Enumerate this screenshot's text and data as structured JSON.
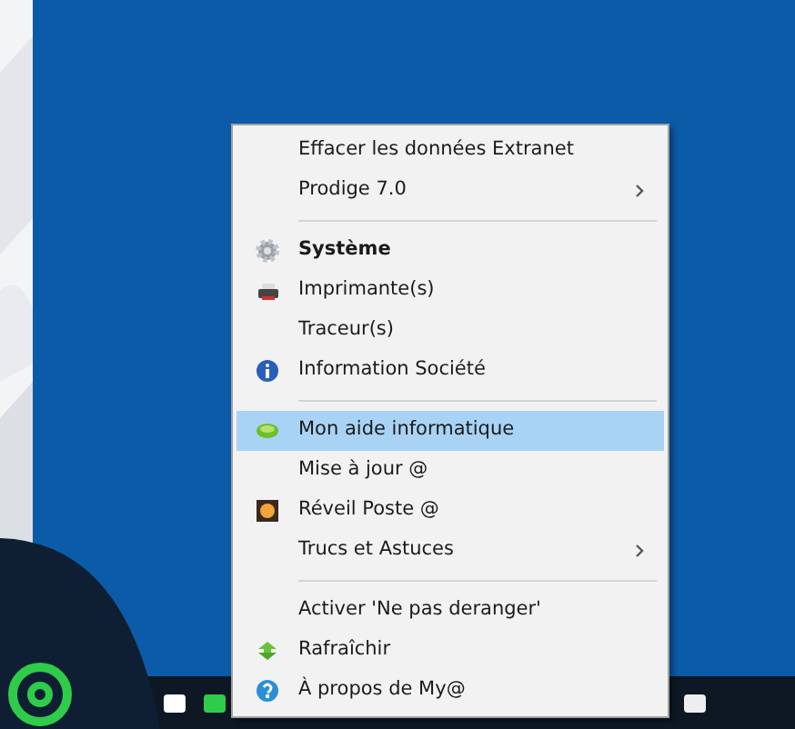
{
  "context_menu": {
    "items": [
      {
        "kind": "item",
        "label": "Effacer les données Extranet",
        "bold": false,
        "submenu": false,
        "selected": false
      },
      {
        "kind": "item",
        "label": "Prodige 7.0",
        "bold": false,
        "submenu": true,
        "selected": false
      },
      {
        "kind": "separator"
      },
      {
        "kind": "item",
        "label": "Système",
        "bold": true,
        "submenu": false,
        "selected": false
      },
      {
        "kind": "item",
        "label": "Imprimante(s)",
        "bold": false,
        "submenu": false,
        "selected": false
      },
      {
        "kind": "item",
        "label": "Traceur(s)",
        "bold": false,
        "submenu": false,
        "selected": false
      },
      {
        "kind": "item",
        "label": "Information Société",
        "bold": false,
        "submenu": false,
        "selected": false
      },
      {
        "kind": "separator"
      },
      {
        "kind": "item",
        "label": "Mon aide informatique",
        "bold": false,
        "submenu": false,
        "selected": true
      },
      {
        "kind": "item",
        "label": "Mise à jour @",
        "bold": false,
        "submenu": false,
        "selected": false
      },
      {
        "kind": "item",
        "label": "Réveil Poste @",
        "bold": false,
        "submenu": false,
        "selected": false
      },
      {
        "kind": "item",
        "label": "Trucs et Astuces",
        "bold": false,
        "submenu": true,
        "selected": false
      },
      {
        "kind": "separator"
      },
      {
        "kind": "item",
        "label": "Activer 'Ne pas deranger'",
        "bold": false,
        "submenu": false,
        "selected": false
      },
      {
        "kind": "item",
        "label": "Rafraîchir",
        "bold": false,
        "submenu": false,
        "selected": false
      },
      {
        "kind": "item",
        "label": "À propos de My@",
        "bold": false,
        "submenu": false,
        "selected": false
      }
    ]
  }
}
